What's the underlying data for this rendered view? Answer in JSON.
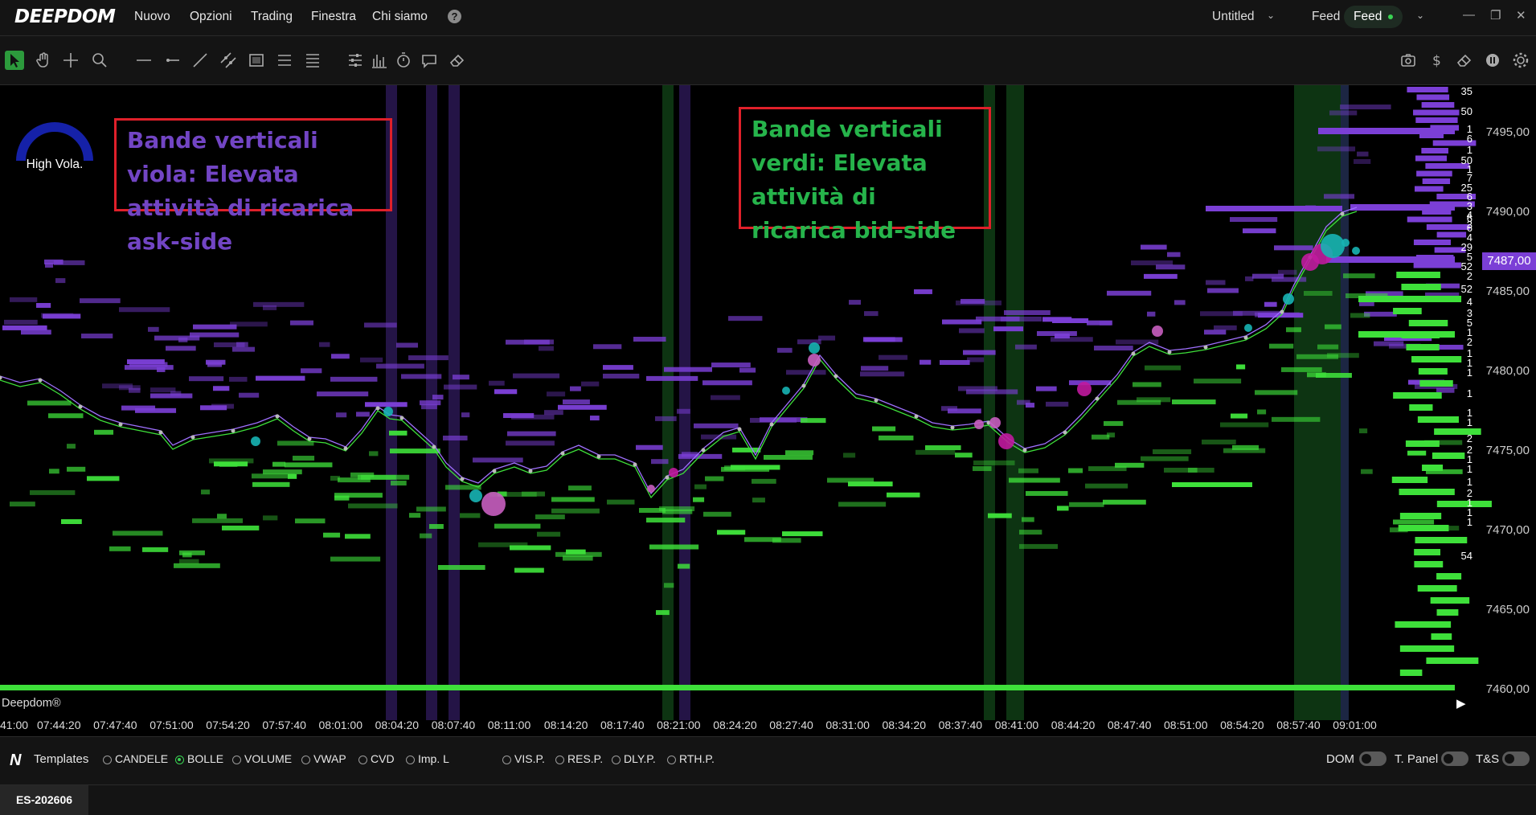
{
  "menubar": {
    "logo": "DEEPDOM",
    "items": [
      "Nuovo",
      "Opzioni",
      "Trading",
      "Finestra",
      "Chi siamo"
    ],
    "workspace": "Untitled",
    "feed_label": "Feed",
    "feed_status": "Feed",
    "feed_status_color": "#39d353"
  },
  "toolbar": {
    "tools": [
      "select-icon",
      "hand-icon",
      "crosshair-icon",
      "zoom-icon",
      "horizontal-line-icon",
      "ray-icon",
      "trendline-icon",
      "channel-icon",
      "rectangle-icon",
      "lines-icon",
      "lines-alt-icon",
      "settings-sliders-icon",
      "bar-chart-icon",
      "timer-icon",
      "comment-icon",
      "eraser-icon"
    ],
    "right_tools": [
      "camera-icon",
      "dollar-icon",
      "eraser-icon",
      "pause-icon",
      "gear-icon"
    ]
  },
  "chart": {
    "indicator_label": "High Vola.",
    "annotation_purple": "Bande verticali viola: Elevata attività di ricarica ask-side",
    "annotation_green": "Bande verticali verdi: Elevata attività di ricarica bid-side",
    "current_price": "7487,00",
    "price_labels": [
      "7495,00",
      "7490,00",
      "7485,00",
      "7480,00",
      "7475,00",
      "7470,00",
      "7465,00",
      "7460,00"
    ],
    "time_labels": [
      "41:00",
      "07:44:20",
      "07:47:40",
      "07:51:00",
      "07:54:20",
      "07:57:40",
      "08:01:00",
      "08:04:20",
      "08:07:40",
      "08:11:00",
      "08:14:20",
      "08:17:40",
      "08:21:00",
      "08:24:20",
      "08:27:40",
      "08:31:00",
      "08:34:20",
      "08:37:40",
      "08:41:00",
      "08:44:20",
      "08:47:40",
      "08:51:00",
      "08:54:20",
      "08:57:40",
      "09:01:00"
    ],
    "brand": "Deepdom®",
    "ask_counts": [
      "35",
      "50",
      "1",
      "6",
      "1",
      "50",
      "1",
      "7",
      "25",
      "6",
      "3",
      "4",
      "3"
    ],
    "bid_counts": [
      "6",
      "6",
      "4",
      "29",
      "5",
      "52",
      "2",
      "52",
      "4",
      "3",
      "5",
      "1",
      "2",
      "1",
      "1",
      "1",
      "1",
      "1",
      "1",
      "2",
      "2",
      "1",
      "1",
      "1",
      "2",
      "1",
      "1",
      "1",
      "54"
    ],
    "ask_color": "#7b3fd6",
    "bid_color": "#3ee03a"
  },
  "bottombar": {
    "templates_label": "Templates",
    "options": [
      {
        "label": "CANDELE",
        "on": false
      },
      {
        "label": "BOLLE",
        "on": true
      },
      {
        "label": "VOLUME",
        "on": false
      },
      {
        "label": "VWAP",
        "on": false
      },
      {
        "label": "CVD",
        "on": false
      },
      {
        "label": "Imp. L",
        "on": false
      },
      {
        "label": "VIS.P.",
        "on": false
      },
      {
        "label": "RES.P.",
        "on": false
      },
      {
        "label": "DLY.P.",
        "on": false
      },
      {
        "label": "RTH.P.",
        "on": false
      }
    ],
    "toggles": [
      "DOM",
      "T. Panel",
      "T&S"
    ]
  },
  "statusbar": {
    "symbol": "ES-202606"
  }
}
